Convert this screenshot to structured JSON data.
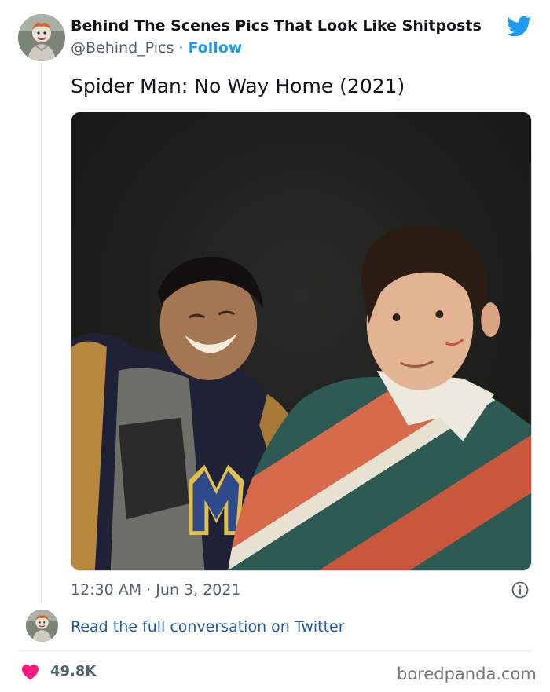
{
  "author": {
    "display_name": "Behind The Scenes Pics That Look Like Shitposts",
    "handle": "@Behind_Pics",
    "separator": "·",
    "follow_label": "Follow",
    "avatar_icon": "avatar-image"
  },
  "tweet": {
    "text": "Spider Man: No Way Home (2021)",
    "timestamp": "12:30 AM · Jun 3, 2021",
    "media_icon": "photo-image"
  },
  "footer": {
    "read_conversation_label": "Read the full conversation on Twitter",
    "like_count": "49.8K",
    "like_icon": "heart-icon"
  },
  "watermark": "boredpanda.com",
  "colors": {
    "twitter_blue": "#1d9bf0",
    "heart_pink": "#f91880",
    "text_primary": "#0f1419",
    "text_secondary": "#536471"
  }
}
